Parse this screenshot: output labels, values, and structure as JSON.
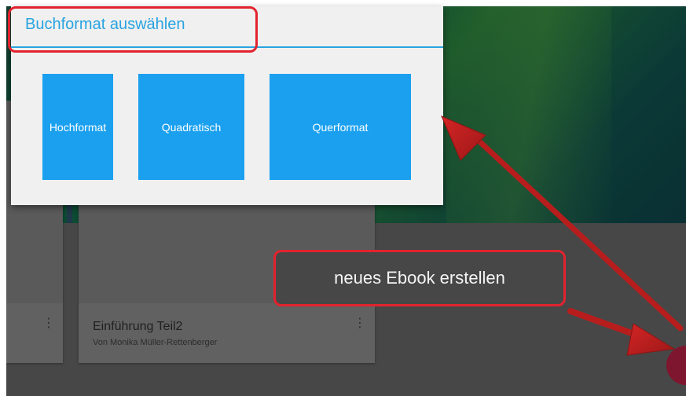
{
  "dialog": {
    "title": "Buchformat auswählen",
    "formats": [
      {
        "label": "Hochformat"
      },
      {
        "label": "Quadratisch"
      },
      {
        "label": "Querformat"
      }
    ]
  },
  "library": {
    "books": [
      {
        "title": "Einführung Teil2",
        "author": "Von Monika Müller-Rettenberger",
        "menu_icon": "⋮"
      }
    ],
    "left_card_menu_icon": "⋮"
  },
  "annotation": {
    "label": "neues Ebook erstellen",
    "color": "#e2232f"
  },
  "colors": {
    "accent": "#29a3e0",
    "button": "#1aa0ef",
    "fab": "#7f1630"
  }
}
